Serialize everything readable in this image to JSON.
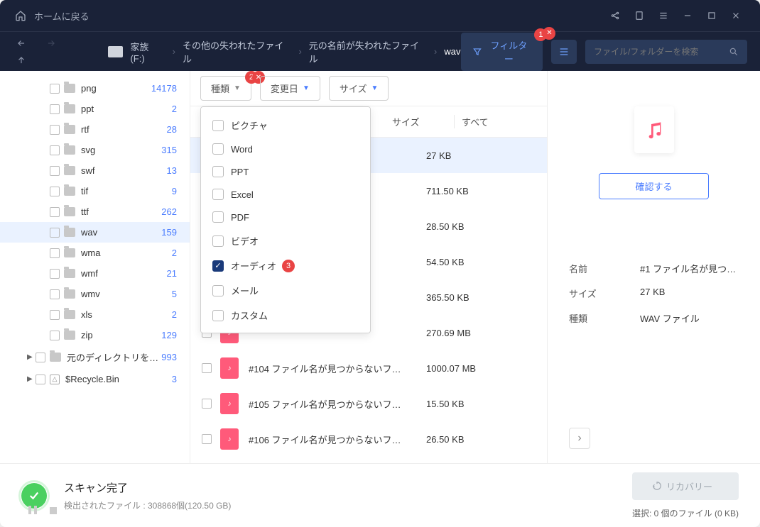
{
  "titlebar": {
    "home": "ホームに戻る"
  },
  "breadcrumb": {
    "drive": "家族 (F:)",
    "c1": "その他の失われたファイル",
    "c2": "元の名前が失われたファイル",
    "c3": "wav"
  },
  "filter_btn": "フィルター",
  "filter_badge": "1",
  "search_placeholder": "ファイル/フォルダーを検索",
  "filters": {
    "type": "種類",
    "type_badge": "2",
    "date": "変更日",
    "size": "サイズ"
  },
  "dropdown": {
    "picture": "ピクチャ",
    "word": "Word",
    "ppt": "PPT",
    "excel": "Excel",
    "pdf": "PDF",
    "video": "ビデオ",
    "audio": "オーディオ",
    "audio_badge": "3",
    "mail": "メール",
    "custom": "カスタム"
  },
  "table": {
    "size": "サイズ",
    "all": "すべて"
  },
  "tree": [
    {
      "name": "png",
      "count": "14178"
    },
    {
      "name": "ppt",
      "count": "2"
    },
    {
      "name": "rtf",
      "count": "28"
    },
    {
      "name": "svg",
      "count": "315"
    },
    {
      "name": "swf",
      "count": "13"
    },
    {
      "name": "tif",
      "count": "9"
    },
    {
      "name": "ttf",
      "count": "262"
    },
    {
      "name": "wav",
      "count": "159"
    },
    {
      "name": "wma",
      "count": "2"
    },
    {
      "name": "wmf",
      "count": "21"
    },
    {
      "name": "wmv",
      "count": "5"
    },
    {
      "name": "xls",
      "count": "2"
    },
    {
      "name": "zip",
      "count": "129"
    }
  ],
  "tree_root": [
    {
      "name": "元のディレクトリを失っ…",
      "count": "993"
    },
    {
      "name": "$Recycle.Bin",
      "count": "3"
    }
  ],
  "rows": [
    {
      "name": "",
      "size": "27 KB"
    },
    {
      "name": "",
      "size": "711.50 KB"
    },
    {
      "name": "",
      "size": "28.50 KB"
    },
    {
      "name": "",
      "size": "54.50 KB"
    },
    {
      "name": "",
      "size": "365.50 KB"
    },
    {
      "name": "",
      "size": "270.69 MB"
    },
    {
      "name": "#104 ファイル名が見つからないフ…",
      "size": "1000.07 MB"
    },
    {
      "name": "#105 ファイル名が見つからないフ…",
      "size": "15.50 KB"
    },
    {
      "name": "#106 ファイル名が見つからないフ…",
      "size": "26.50 KB"
    }
  ],
  "detail": {
    "confirm": "確認する",
    "name_label": "名前",
    "name_val": "#1 ファイル名が見つ…",
    "size_label": "サイズ",
    "size_val": "27 KB",
    "type_label": "種類",
    "type_val": "WAV ファイル"
  },
  "status": {
    "title": "スキャン完了",
    "sub": "検出されたファイル : 308868個(120.50 GB)",
    "recovery": "リカバリー",
    "selected": "選択: 0 個のファイル (0 KB)"
  }
}
